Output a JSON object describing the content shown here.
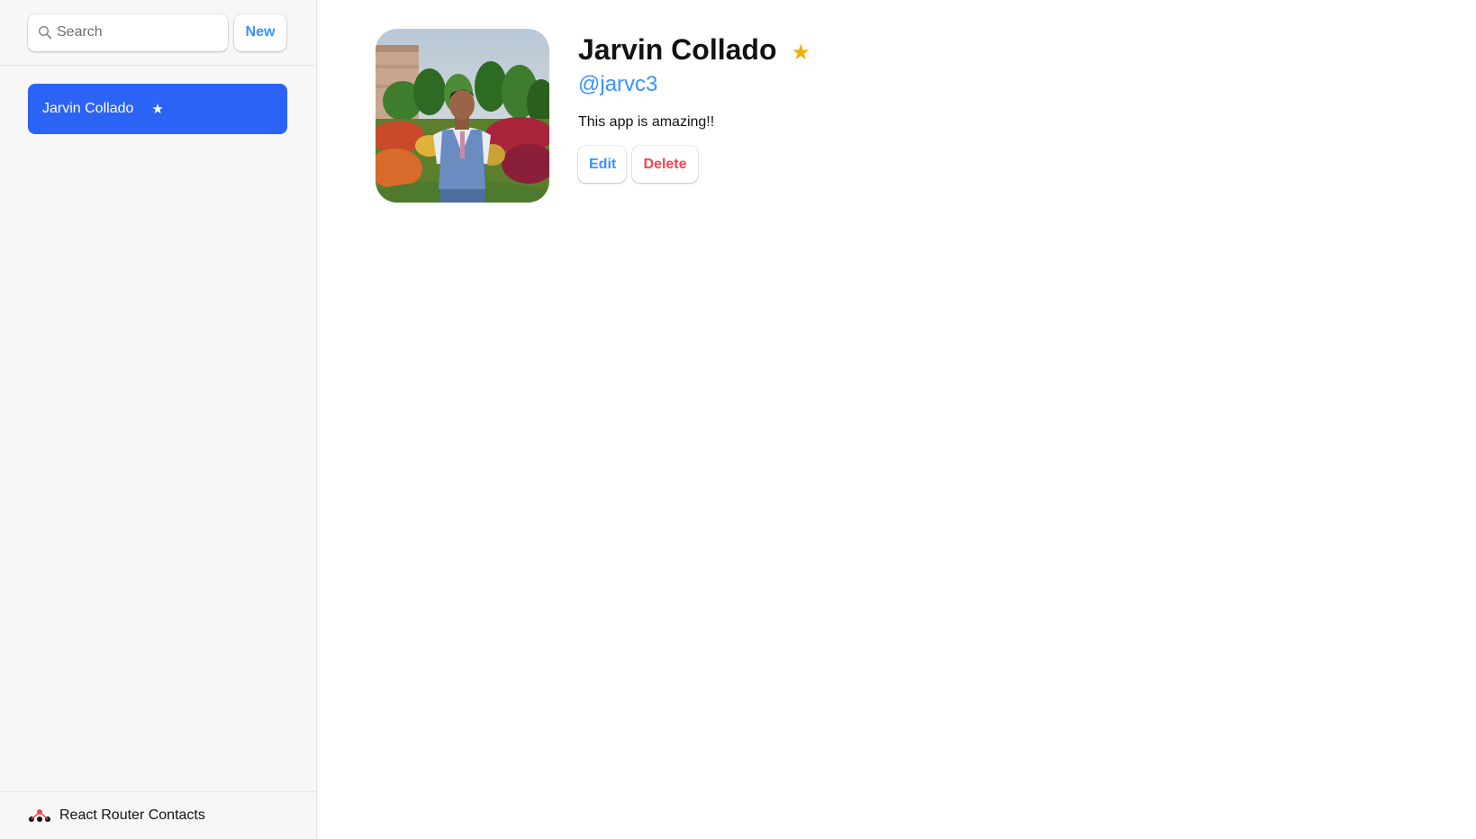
{
  "sidebar": {
    "search": {
      "placeholder": "Search",
      "value": ""
    },
    "new_label": "New",
    "contacts": [
      {
        "name": "Jarvin Collado",
        "favorite": true,
        "favorite_icon": "★",
        "active": true
      }
    ],
    "footer_title": "React Router Contacts"
  },
  "contact": {
    "name": "Jarvin Collado",
    "favorite_icon": "★",
    "handle": "@jarvc3",
    "notes": "This app is amazing!!",
    "edit_label": "Edit",
    "delete_label": "Delete"
  },
  "colors": {
    "accent": "#3992ff",
    "active_item": "#2b63f5",
    "danger": "#f44250",
    "favorite": "#eeb004"
  },
  "icons": {
    "search": "search-icon",
    "favorite": "star-icon",
    "logo": "react-router-logo-icon"
  }
}
